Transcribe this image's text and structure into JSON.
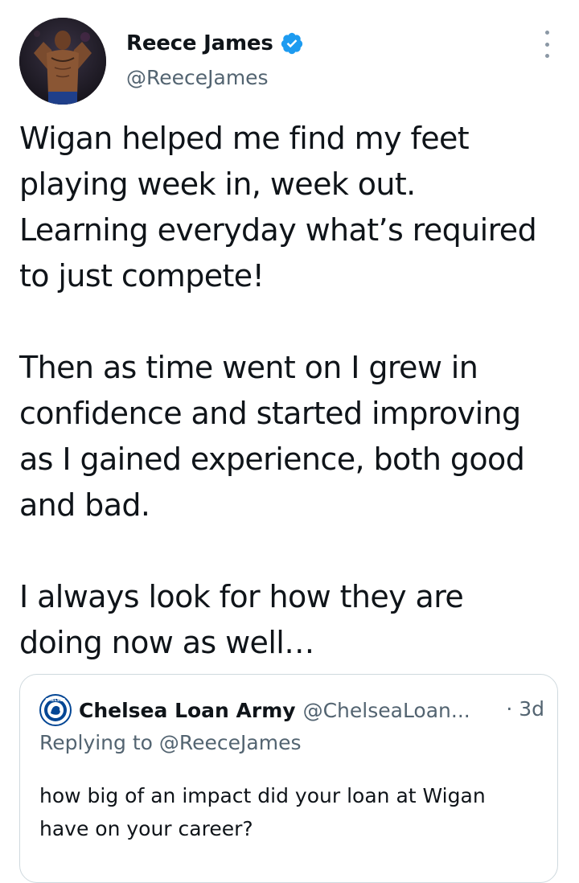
{
  "author": {
    "display_name": "Reece James",
    "handle": "@ReeceJames",
    "verified": true,
    "avatar_icon": "profile-photo"
  },
  "tweet": {
    "paragraphs": [
      [
        "Wigan helped me find my feet",
        "playing week in, week out.",
        "Learning everyday what’s required",
        "to just compete!"
      ],
      [
        "Then as time went on I grew in",
        "confidence and started improving",
        "as I gained experience, both good",
        "and bad."
      ],
      [
        "I always look for how they are",
        "doing now as well…"
      ]
    ]
  },
  "quoted_tweet": {
    "display_name": "Chelsea Loan Army",
    "handle": "@ChelseaLoan...",
    "separator": "·",
    "time": "3d",
    "reply_prefix": "Replying to",
    "reply_to": "@ReeceJames",
    "body_lines": [
      "how big of an impact did your loan at Wigan",
      "have on your career?"
    ],
    "avatar_icon": "chelsea-crest",
    "avatar_text": "CHELSEA"
  },
  "colors": {
    "text": "#0f1419",
    "secondary": "#536471",
    "verified_blue": "#1d9bf0",
    "border": "#cfd9de"
  }
}
